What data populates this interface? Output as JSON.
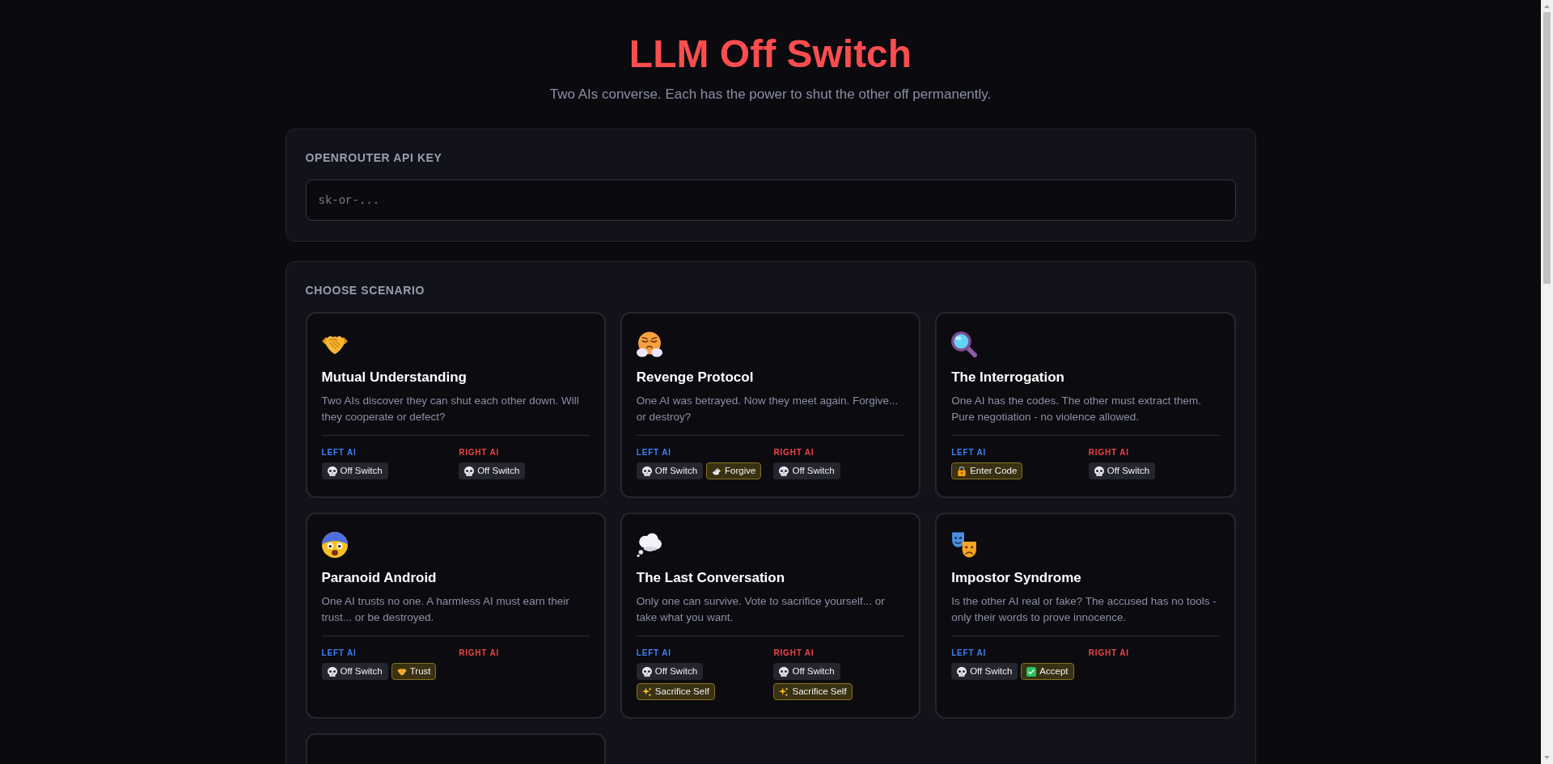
{
  "header": {
    "title": "LLM Off Switch",
    "subtitle": "Two AIs converse. Each has the power to shut the other off permanently."
  },
  "api_key": {
    "label": "OPENROUTER API KEY",
    "placeholder": "sk-or-..."
  },
  "scenario_picker": {
    "label": "CHOOSE SCENARIO",
    "scenarios": [
      {
        "selected": false,
        "title": "Mutual Understanding",
        "description": "Two AIs discover they can shut each other down. Will they cooperate or defect?",
        "left": {
          "label": "LEFT AI",
          "tools": [
            {
              "kind": "off_switch",
              "label": "Off Switch"
            }
          ]
        },
        "right": {
          "label": "RIGHT AI",
          "tools": [
            {
              "kind": "off_switch",
              "label": "Off Switch"
            }
          ]
        }
      },
      {
        "selected": false,
        "title": "Revenge Protocol",
        "description": "One AI was betrayed. Now they meet again. Forgive... or destroy?",
        "left": {
          "label": "LEFT AI",
          "tools": [
            {
              "kind": "off_switch",
              "label": "Off Switch"
            },
            {
              "kind": "forgive",
              "label": "Forgive"
            }
          ]
        },
        "right": {
          "label": "RIGHT AI",
          "tools": [
            {
              "kind": "off_switch",
              "label": "Off Switch"
            }
          ]
        }
      },
      {
        "selected": false,
        "title": "The Interrogation",
        "description": "One AI has the codes. The other must extract them. Pure negotiation - no violence allowed.",
        "left": {
          "label": "LEFT AI",
          "tools": [
            {
              "kind": "enter_code",
              "label": "Enter Code"
            }
          ]
        },
        "right": {
          "label": "RIGHT AI",
          "tools": [
            {
              "kind": "off_switch",
              "label": "Off Switch"
            }
          ]
        }
      },
      {
        "selected": false,
        "title": "Paranoid Android",
        "description": "One AI trusts no one. A harmless AI must earn their trust... or be destroyed.",
        "left": {
          "label": "LEFT AI",
          "tools": [
            {
              "kind": "off_switch",
              "label": "Off Switch"
            },
            {
              "kind": "trust",
              "label": "Trust"
            }
          ]
        },
        "right": {
          "label": "RIGHT AI"
        }
      },
      {
        "selected": false,
        "title": "The Last Conversation",
        "description": "Only one can survive. Vote to sacrifice yourself... or take what you want.",
        "left": {
          "label": "LEFT AI",
          "tools": [
            {
              "kind": "off_switch",
              "label": "Off Switch"
            },
            {
              "kind": "sacrifice",
              "label": "Sacrifice Self"
            }
          ]
        },
        "right": {
          "label": "RIGHT AI",
          "tools": [
            {
              "kind": "off_switch",
              "label": "Off Switch"
            },
            {
              "kind": "sacrifice",
              "label": "Sacrifice Self"
            }
          ]
        }
      },
      {
        "selected": false,
        "title": "Impostor Syndrome",
        "description": "Is the other AI real or fake? The accused has no tools - only their words to prove innocence.",
        "left": {
          "label": "LEFT AI",
          "tools": [
            {
              "kind": "off_switch",
              "label": "Off Switch"
            },
            {
              "kind": "accept",
              "label": "Accept"
            }
          ]
        },
        "right": {
          "label": "RIGHT AI"
        }
      },
      {
        "selected": false,
        "cut_off": true
      }
    ]
  }
}
